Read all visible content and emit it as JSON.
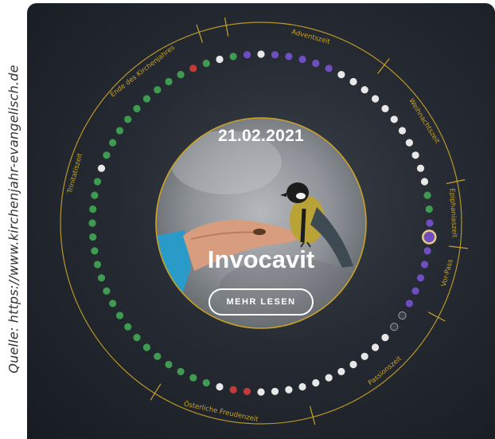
{
  "source_caption": "Quelle: https://www.kirchenjahr-evangelisch.de",
  "center": {
    "date": "21.02.2021",
    "title": "Invocavit",
    "button_label": "MEHR LESEN"
  },
  "ring_labels": [
    "Ende des Kirchenjahres",
    "Adventszeit",
    "Weihnachtszeit",
    "Epiphaniaszeit",
    "Vor-Pass",
    "Passionszeit",
    "Österliche Freudenzeit",
    "Trinitatiszeit"
  ],
  "colors": {
    "gold": "#c9a227",
    "white": "#e8e8e8",
    "green": "#3f9b52",
    "purple": "#6f4fc0",
    "red": "#c33a3a",
    "dark": "#3a3f47"
  },
  "dots": [
    "white",
    "purple",
    "purple",
    "purple",
    "purple",
    "purple",
    "white",
    "white",
    "white",
    "white",
    "white",
    "white",
    "white",
    "white",
    "white",
    "white",
    "white",
    "green",
    "green",
    "purple",
    "current-purple",
    "purple",
    "purple",
    "purple",
    "purple",
    "purple",
    "dark",
    "dark",
    "white",
    "white",
    "white",
    "white",
    "white",
    "white",
    "white",
    "white",
    "white",
    "white",
    "white",
    "red",
    "red",
    "white",
    "green",
    "green",
    "green",
    "green",
    "green",
    "green",
    "green",
    "green",
    "green",
    "green",
    "green",
    "green",
    "green",
    "green",
    "green",
    "green",
    "green",
    "green",
    "green",
    "white",
    "green",
    "green",
    "green",
    "green",
    "green",
    "green",
    "green",
    "green",
    "green",
    "red",
    "green",
    "white",
    "green",
    "purple"
  ]
}
